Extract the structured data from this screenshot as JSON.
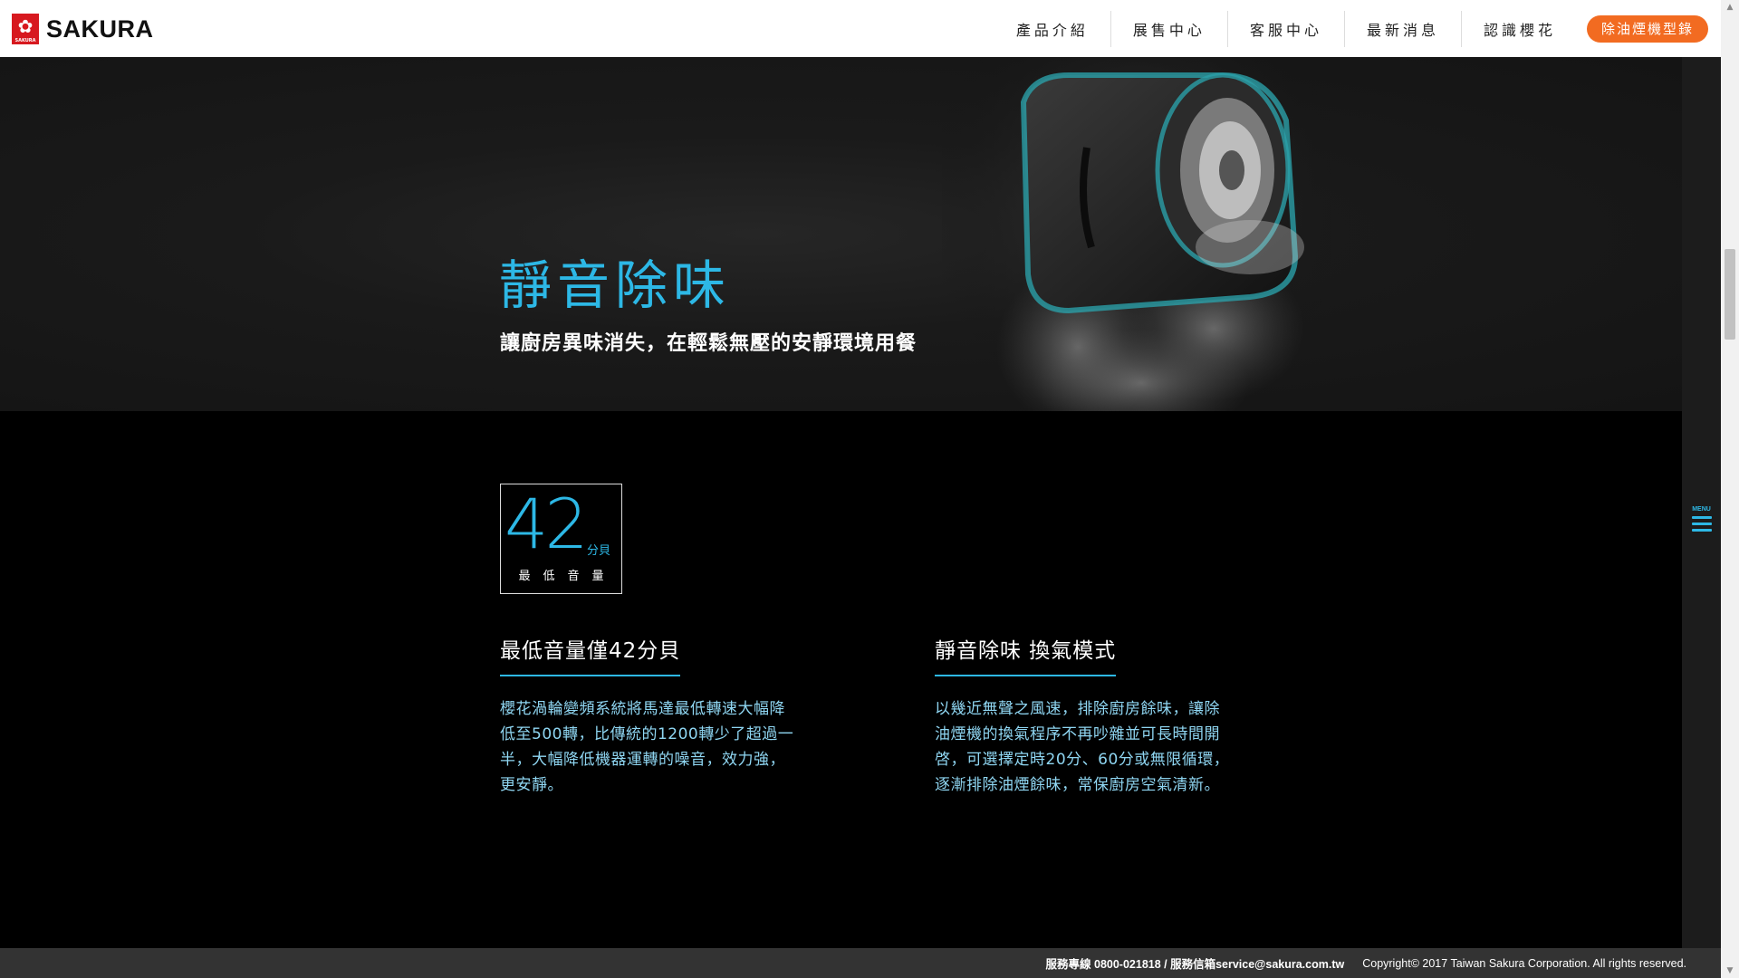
{
  "header": {
    "logo_text": "SAKURA",
    "logo_small": "SAKURA",
    "nav": [
      "產品介紹",
      "展售中心",
      "客服中心",
      "最新消息",
      "認識櫻花"
    ],
    "cta": "除油煙機型錄"
  },
  "hero": {
    "title": "靜音除味",
    "subtitle": "讓廚房異味消失，在輕鬆無壓的安靜環境用餐"
  },
  "badge": {
    "number": "42",
    "unit": "分貝",
    "label": "最低音量"
  },
  "columns": [
    {
      "title": "最低音量僅42分貝",
      "text": "櫻花渦輪變頻系統將馬達最低轉速大幅降低至500轉，比傳統的1200轉少了超過一半，大幅降低機器運轉的噪音，效力強，更安靜。"
    },
    {
      "title": "靜音除味 換氣模式",
      "text": "以幾近無聲之風速，排除廚房餘味，讓除油煙機的換氣程序不再吵雜並可長時間開啓，可選擇定時20分、60分或無限循環，逐漸排除油煙餘味，常保廚房空氣清新。"
    }
  ],
  "menu": {
    "label": "MENU"
  },
  "footer": {
    "contact": "服務專線 0800-021818 / 服務信箱service@sakura.com.tw",
    "copyright": "Copyright© 2017 Taiwan Sakura Corporation. All rights reserved."
  },
  "colors": {
    "accent": "#2db8e6",
    "cta": "#f26b21",
    "brand_red": "#d7191f"
  }
}
